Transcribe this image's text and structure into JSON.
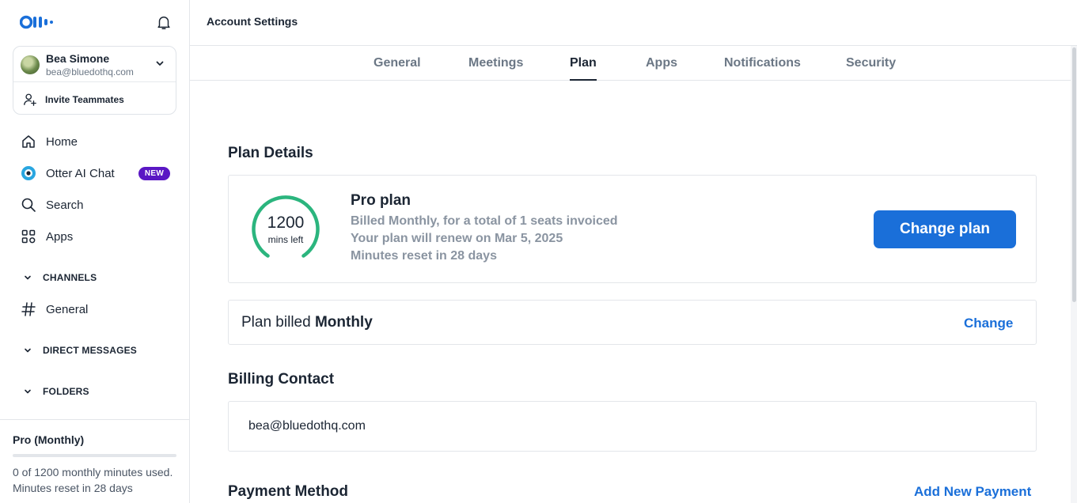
{
  "sidebar": {
    "logo": "otter-logo",
    "user": {
      "name": "Bea Simone",
      "email": "bea@bluedothq.com"
    },
    "invite_label": "Invite Teammates",
    "nav": [
      {
        "label": "Home",
        "icon": "home-icon"
      },
      {
        "label": "Otter AI Chat",
        "icon": "otter-chat-icon",
        "badge": "NEW"
      },
      {
        "label": "Search",
        "icon": "search-icon"
      },
      {
        "label": "Apps",
        "icon": "apps-icon"
      }
    ],
    "sections": {
      "channels": "CHANNELS",
      "channel_general": "General",
      "direct_messages": "DIRECT MESSAGES",
      "folders": "FOLDERS"
    },
    "footer": {
      "plan": "Pro (Monthly)",
      "usage_fraction": 0,
      "usage_text": "0 of 1200 monthly minutes used. Minutes reset in 28 days"
    }
  },
  "header": {
    "title": "Account Settings"
  },
  "tabs": [
    {
      "label": "General"
    },
    {
      "label": "Meetings"
    },
    {
      "label": "Plan",
      "active": true
    },
    {
      "label": "Apps"
    },
    {
      "label": "Notifications"
    },
    {
      "label": "Security"
    }
  ],
  "main": {
    "plan_details_heading": "Plan Details",
    "gauge": {
      "value": "1200",
      "unit": "mins left",
      "remaining_fraction": 1
    },
    "plan": {
      "title": "Pro plan",
      "line1": "Billed Monthly, for a total of 1 seats invoiced",
      "line2": "Your plan will renew on Mar 5, 2025",
      "line3": "Minutes reset in 28 days",
      "change_plan_label": "Change plan"
    },
    "billing": {
      "prefix": "Plan billed ",
      "period": "Monthly",
      "change_label": "Change"
    },
    "billing_contact_heading": "Billing Contact",
    "billing_contact_email": "bea@bluedothq.com",
    "payment_method_heading": "Payment Method",
    "add_payment_label": "Add New Payment"
  },
  "colors": {
    "accent": "#1a6fd9",
    "gauge": "#2bb57e",
    "badge": "#5a17c4",
    "text": "#1b2533",
    "muted": "#8a94a1"
  }
}
